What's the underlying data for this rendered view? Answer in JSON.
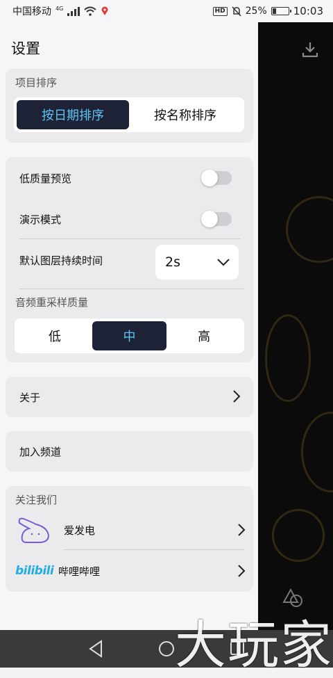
{
  "status_bar": {
    "carrier": "中国移动",
    "network": "4G",
    "hd_badge": "HD",
    "battery_percent": "25%",
    "battery_level": 0.25,
    "time": "10:03"
  },
  "settings": {
    "title": "设置",
    "project_sort": {
      "label": "项目排序",
      "options": [
        "按日期排序",
        "按名称排序"
      ],
      "selected": "按日期排序"
    },
    "low_quality_preview": {
      "label": "低质量预览",
      "enabled": false
    },
    "demo_mode": {
      "label": "演示模式",
      "enabled": false
    },
    "default_layer_duration": {
      "label": "默认图层持续时间",
      "value": "2s"
    },
    "audio_resample_quality": {
      "label": "音频重采样质量",
      "options": [
        "低",
        "中",
        "高"
      ],
      "selected": "中"
    },
    "about": {
      "label": "关于"
    },
    "join_channel": {
      "label": "加入频道"
    },
    "follow_us": {
      "label": "关注我们",
      "items": [
        {
          "name": "爱发电",
          "icon": "afdian-logo-icon"
        },
        {
          "name": "哔哩哔哩",
          "icon": "bilibili-logo-icon",
          "logo_text": "bilibili"
        }
      ]
    }
  },
  "watermark": "大玩家",
  "colors": {
    "accent": "#5ec4f3",
    "selected_bg": "#1e2236",
    "card_bg": "#ebebee"
  }
}
